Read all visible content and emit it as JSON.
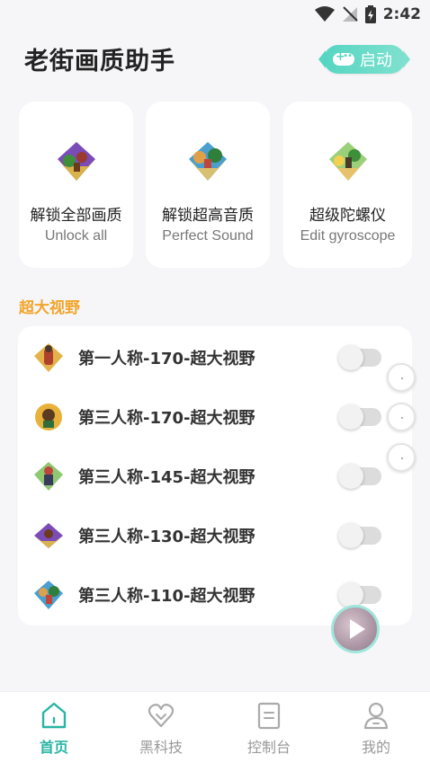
{
  "status_bar": {
    "time": "2:42"
  },
  "header": {
    "title": "老街画质助手",
    "start_label": "启动"
  },
  "feature_cards": [
    {
      "title": "解锁全部画质",
      "subtitle": "Unlock all"
    },
    {
      "title": "解锁超高音质",
      "subtitle": "Perfect Sound"
    },
    {
      "title": "超级陀螺仪",
      "subtitle": "Edit gyroscope"
    }
  ],
  "section": {
    "title": "超大视野"
  },
  "fov_items": [
    {
      "label": "第一人称-170-超大视野",
      "enabled": false
    },
    {
      "label": "第三人称-170-超大视野",
      "enabled": false
    },
    {
      "label": "第三人称-145-超大视野",
      "enabled": false
    },
    {
      "label": "第三人称-130-超大视野",
      "enabled": false
    },
    {
      "label": "第三人称-110-超大视野",
      "enabled": false
    }
  ],
  "bottom_nav": [
    {
      "label": "首页",
      "active": true
    },
    {
      "label": "黑科技",
      "active": false
    },
    {
      "label": "控制台",
      "active": false
    },
    {
      "label": "我的",
      "active": false
    }
  ],
  "colors": {
    "accent": "#28b5a3",
    "section": "#f2a52b",
    "start_button": "#55d6c2"
  }
}
